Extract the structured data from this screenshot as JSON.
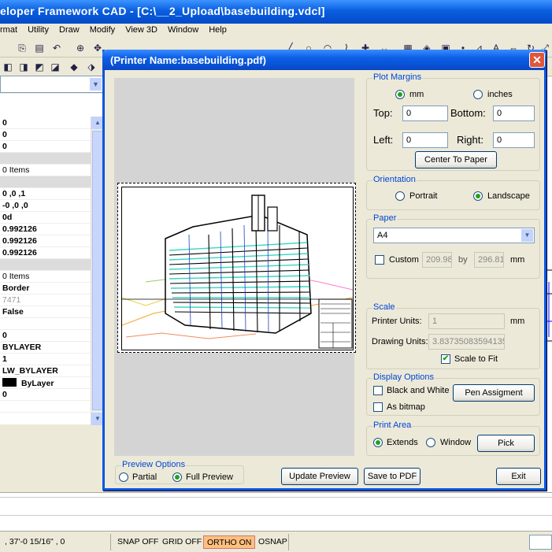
{
  "app": {
    "title": "eloper Framework CAD - [C:\\__2_Upload\\basebuilding.vdcl]",
    "menu": [
      "rmat",
      "Utility",
      "Draw",
      "Modify",
      "View 3D",
      "Window",
      "Help"
    ]
  },
  "properties": {
    "rows": [
      {
        "text": "0",
        "style": "bold"
      },
      {
        "text": "0",
        "style": "bold"
      },
      {
        "text": "0",
        "style": "bold"
      },
      {
        "text": "",
        "style": "cat"
      },
      {
        "text": "0 Items",
        "style": "norm"
      },
      {
        "text": "",
        "style": "cat"
      },
      {
        "text": "0 ,0 ,1",
        "style": "bold"
      },
      {
        "text": "-0 ,0 ,0",
        "style": "bold"
      },
      {
        "text": "0d",
        "style": "bold"
      },
      {
        "text": "0.992126",
        "style": "bold"
      },
      {
        "text": "0.992126",
        "style": "bold"
      },
      {
        "text": "0.992126",
        "style": "bold"
      },
      {
        "text": "",
        "style": "cat"
      },
      {
        "text": "0 Items",
        "style": "norm"
      },
      {
        "text": "Border",
        "style": "bold"
      },
      {
        "text": "7471",
        "style": "gray"
      },
      {
        "text": "False",
        "style": "bold"
      },
      {
        "text": "",
        "style": "norm"
      },
      {
        "text": "0",
        "style": "bold"
      },
      {
        "text": "BYLAYER",
        "style": "bold"
      },
      {
        "text": "1",
        "style": "bold"
      },
      {
        "text": "LW_BYLAYER",
        "style": "bold"
      },
      {
        "text": "ByLayer",
        "style": "swatch"
      },
      {
        "text": "0",
        "style": "bold"
      },
      {
        "text": "",
        "style": "norm"
      }
    ]
  },
  "statusbar": {
    "coords": ", 37'-0 15/16\" , 0",
    "snap": "SNAP OFF",
    "grid": "GRID OFF",
    "ortho": "ORTHO ON",
    "osnap": "OSNAP"
  },
  "dialog": {
    "title": "(Printer Name:basebuilding.pdf)",
    "close_glyph": "✕",
    "plot_margins": {
      "title": "Plot Margins",
      "mm_label": "mm",
      "inches_label": "inches",
      "unit": "mm",
      "top_label": "Top:",
      "top_value": "0",
      "bottom_label": "Bottom:",
      "bottom_value": "0",
      "left_label": "Left:",
      "left_value": "0",
      "right_label": "Right:",
      "right_value": "0",
      "center_button": "Center To Paper"
    },
    "orientation": {
      "title": "Orientation",
      "portrait_label": "Portrait",
      "landscape_label": "Landscape",
      "selected": "Landscape"
    },
    "paper": {
      "title": "Paper",
      "size": "A4",
      "custom_label": "Custom",
      "custom_checked": false,
      "width": "209.98",
      "by_label": "by",
      "height": "296.81",
      "unit_label": "mm"
    },
    "scale": {
      "title": "Scale",
      "printer_units_label": "Printer Units:",
      "printer_units_value": "1",
      "printer_units_unit": "mm",
      "drawing_units_label": "Drawing Units:",
      "drawing_units_value": "3.83735083594135",
      "scale_to_fit_label": "Scale to Fit",
      "scale_to_fit_checked": true
    },
    "display_options": {
      "title": "Display Options",
      "bw_label": "Black and White",
      "bitmap_label": "As bitmap",
      "pen_button": "Pen Assigment"
    },
    "print_area": {
      "title": "Print Area",
      "extends_label": "Extends",
      "window_label": "Window",
      "selected": "Extends",
      "pick_button": "Pick"
    },
    "preview_options": {
      "title": "Preview Options",
      "partial_label": "Partial",
      "full_label": "Full Preview",
      "selected": "Full Preview"
    },
    "buttons": {
      "update_preview": "Update Preview",
      "save_pdf": "Save to PDF",
      "exit": "Exit"
    }
  },
  "colors": {
    "titlebar": "#0a5fe0",
    "group_title": "#0046d5",
    "drawing_cyan": "#38d5c6",
    "ortho_on": "#ffbf7f"
  }
}
